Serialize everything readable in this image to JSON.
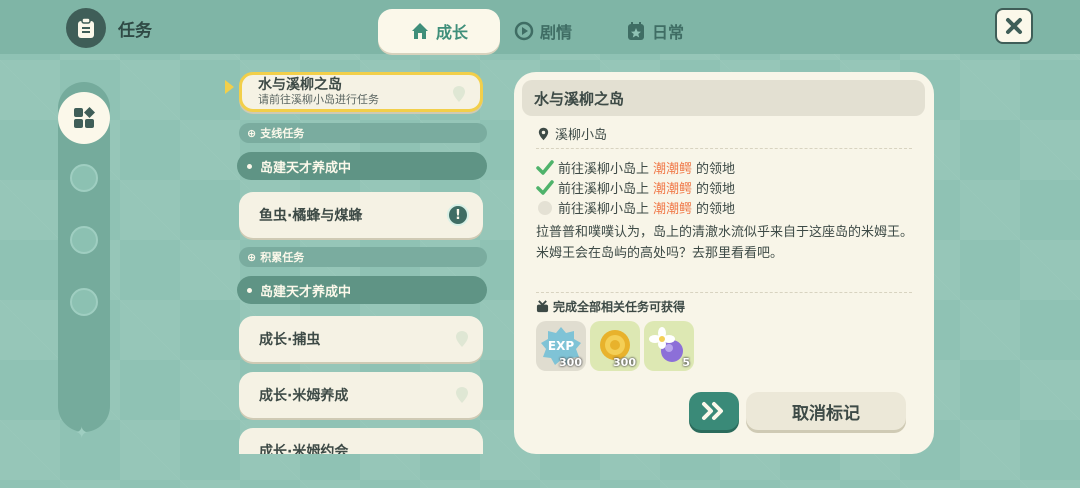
{
  "header": {
    "title": "任务",
    "tabs": [
      {
        "label": "成长",
        "icon": "home-icon",
        "active": true
      },
      {
        "label": "剧情",
        "icon": "film-icon",
        "active": false
      },
      {
        "label": "日常",
        "icon": "calendar-star-icon",
        "active": false
      }
    ]
  },
  "quest_list": {
    "selected": {
      "title": "水与溪柳之岛",
      "subtitle": "请前往溪柳小岛进行任务"
    },
    "sections": [
      {
        "label": "支线任务",
        "group": "岛建天才养成中",
        "items": [
          {
            "label": "鱼虫·橘蜂与煤蜂",
            "alert": true
          }
        ]
      },
      {
        "label": "积累任务",
        "group": "岛建天才养成中",
        "items": [
          {
            "label": "成长·捕虫"
          },
          {
            "label": "成长·米姆养成"
          },
          {
            "label": "成长·米姆约会"
          }
        ]
      }
    ]
  },
  "detail": {
    "title": "水与溪柳之岛",
    "location": "溪柳小岛",
    "objectives": [
      {
        "prefix": "前往溪柳小岛上",
        "highlight": "潮潮鳄",
        "suffix": "的领地",
        "done": true
      },
      {
        "prefix": "前往溪柳小岛上",
        "highlight": "潮潮鳄",
        "suffix": "的领地",
        "done": true
      },
      {
        "prefix": "前往溪柳小岛上",
        "highlight": "潮潮鳄",
        "suffix": "的领地",
        "done": false
      }
    ],
    "description": "拉普普和噗噗认为，岛上的清澈水流似乎来自于这座岛的米姆王。米姆王会在岛屿的高处吗？去那里看看吧。",
    "reward_title": "完成全部相关任务可获得",
    "rewards": [
      {
        "name": "exp-icon",
        "label": "EXP",
        "count": "300"
      },
      {
        "name": "coin-icon",
        "count": "300"
      },
      {
        "name": "flower-orb-icon",
        "count": "5"
      }
    ],
    "cancel_label": "取消标记"
  },
  "colors": {
    "accent": "#3a8a78",
    "highlight": "#f07a4a",
    "selected_border": "#f2cf4a"
  }
}
